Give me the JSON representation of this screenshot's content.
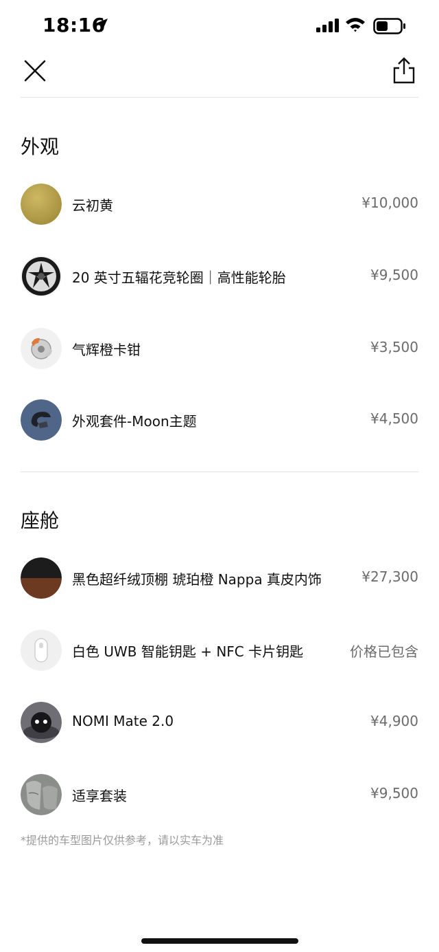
{
  "status_bar": {
    "time": "18:16"
  },
  "header": {
    "close_icon": "close-icon",
    "share_icon": "share-icon"
  },
  "sections": [
    {
      "title": "外观",
      "items": [
        {
          "name": "云初黄",
          "price": "¥10,000",
          "thumb": "swatch-yellow"
        },
        {
          "name": "20 英寸五辐花竞轮圈｜高性能轮胎",
          "price": "¥9,500",
          "thumb": "wheel"
        },
        {
          "name": "气辉橙卡钳",
          "price": "¥3,500",
          "thumb": "caliper"
        },
        {
          "name": "外观套件-Moon主题",
          "price": "¥4,500",
          "thumb": "moon-kit"
        }
      ]
    },
    {
      "title": "座舱",
      "items": [
        {
          "name": "黑色超纤绒顶棚 琥珀橙 Nappa 真皮内饰",
          "price": "¥27,300",
          "thumb": "interior-swatch"
        },
        {
          "name": "白色 UWB 智能钥匙 + NFC 卡片钥匙",
          "price": "价格已包含",
          "thumb": "key"
        },
        {
          "name": "NOMI Mate 2.0",
          "price": "¥4,900",
          "thumb": "nomi"
        },
        {
          "name": "适享套装",
          "price": "¥9,500",
          "thumb": "seat"
        }
      ]
    }
  ],
  "footnote": "*提供的车型图片仅供参考，请以实车为准",
  "colors": {
    "swatch_yellow": "#b8a14c",
    "price_gray": "#6b6b6b",
    "divider": "#e4e4e4"
  }
}
